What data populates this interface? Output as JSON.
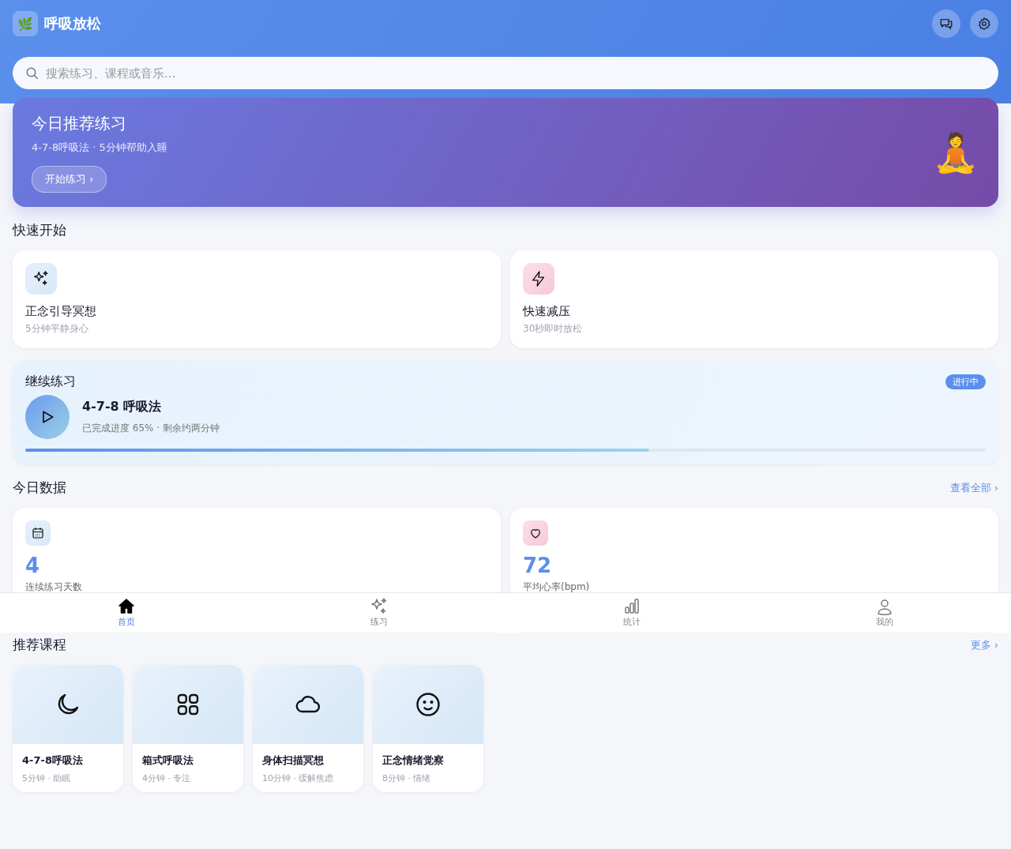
{
  "header": {
    "logo": "🌿",
    "title": "呼吸放松"
  },
  "search": {
    "placeholder": "搜索练习、课程或音乐..."
  },
  "hero": {
    "title": "今日推荐练习",
    "subtitle": "4-7-8呼吸法 · 5分钟帮助入睡",
    "button": "开始练习 ›",
    "emoji": "🧘"
  },
  "quick_start": {
    "title": "快速开始",
    "cards": [
      {
        "kind": "sparkles",
        "title": "正念引导冥想",
        "subtitle": "5分钟平静身心"
      },
      {
        "kind": "bolt",
        "title": "快速减压",
        "subtitle": "30秒即时放松"
      }
    ]
  },
  "continue": {
    "title": "继续练习",
    "badge": "进行中",
    "name": "4-7-8 呼吸法",
    "detail": "已完成进度 65% · 剩余约两分钟",
    "level": 0.65
  },
  "stats": {
    "title": "今日数据",
    "link": "查看全部 ›",
    "cards": [
      {
        "kind": "calendar",
        "value": "4",
        "label": "连续练习天数"
      },
      {
        "kind": "heart",
        "value": "72",
        "label": "平均心率(bpm)"
      }
    ]
  },
  "courses": {
    "title": "推荐课程",
    "link": "更多 ›",
    "items": [
      {
        "kind": "moon",
        "title": "4-7-8呼吸法",
        "meta": "5分钟 · 助眠"
      },
      {
        "kind": "grid",
        "title": "箱式呼吸法",
        "meta": "4分钟 · 专注"
      },
      {
        "kind": "cloud",
        "title": "身体扫描冥想",
        "meta": "10分钟 · 缓解焦虑"
      },
      {
        "kind": "smile",
        "title": "正念情绪觉察",
        "meta": "8分钟 · 情绪"
      }
    ]
  },
  "nav": [
    {
      "kind": "home",
      "label": "首页",
      "selected": true
    },
    {
      "kind": "sparkles",
      "label": "练习",
      "selected": false
    },
    {
      "kind": "chart",
      "label": "统计",
      "selected": false
    },
    {
      "kind": "user",
      "label": "我的",
      "selected": false
    }
  ]
}
